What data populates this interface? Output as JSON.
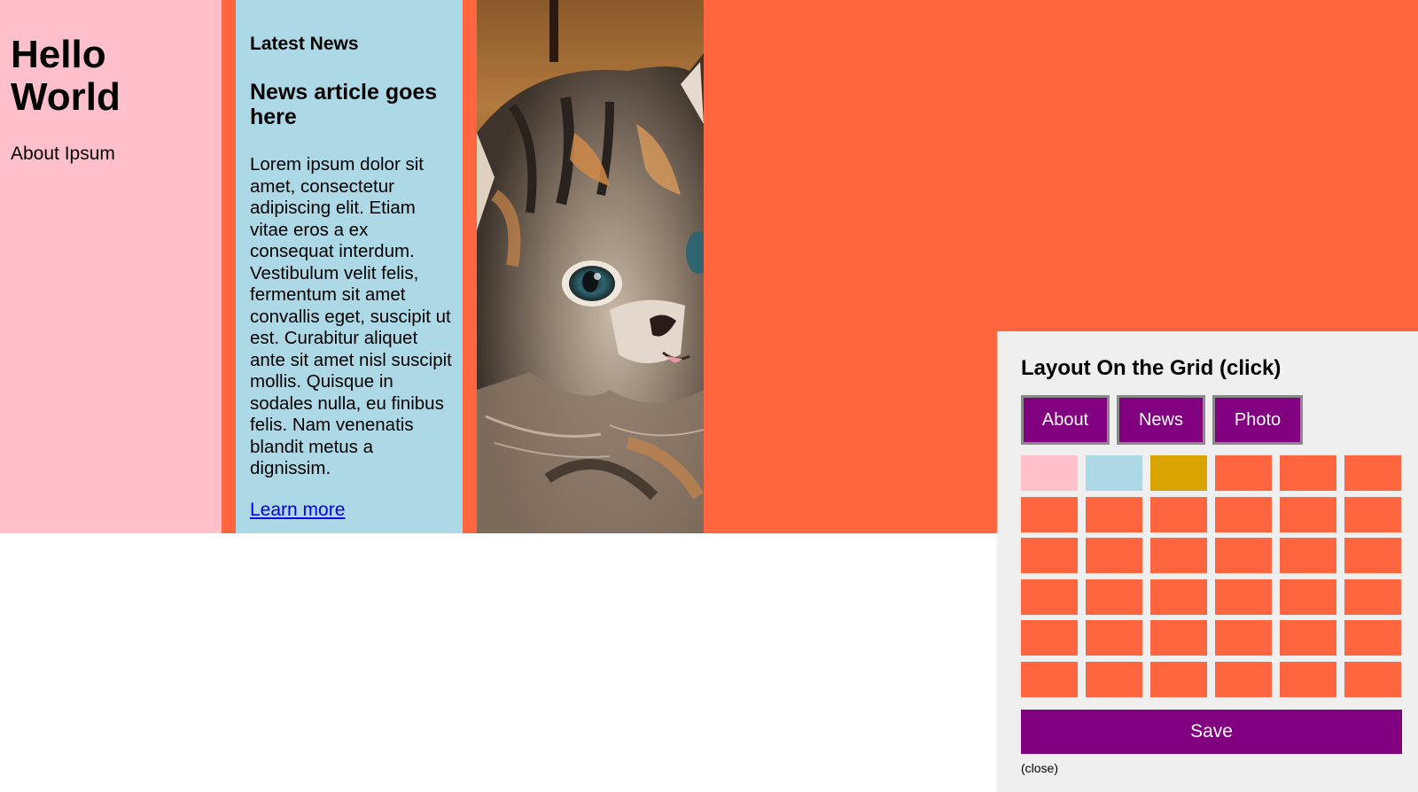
{
  "about": {
    "title": "Hello World",
    "link_label": "About Ipsum"
  },
  "news": {
    "heading": "Latest News",
    "article_title": "News article goes here",
    "body": "Lorem ipsum dolor sit amet, consectetur adipiscing elit. Etiam vitae eros a ex consequat interdum. Vestibulum velit felis, fermentum sit amet convallis eget, suscipit ut est. Curabitur aliquet ante sit amet nisl suscipit mollis. Quisque in sodales nulla, eu finibus felis. Nam venenatis blandit metus a dignissim.",
    "learn_more": "Learn more"
  },
  "photo": {
    "subject": "kitten"
  },
  "dialog": {
    "title": "Layout On the Grid (click)",
    "area_buttons": [
      "About",
      "News",
      "Photo"
    ],
    "grid": {
      "columns": 6,
      "rows": 6,
      "first_row_cells": [
        "about",
        "news",
        "photo",
        "empty",
        "empty",
        "empty"
      ]
    },
    "save_label": "Save",
    "close_label": "(close)"
  },
  "colors": {
    "about": "#FFC0CB",
    "news": "#ADD8E6",
    "photo_selected": "#DAA400",
    "empty": "#FF6640",
    "accent": "#800080",
    "dialog_bg": "#EFEFEF"
  }
}
